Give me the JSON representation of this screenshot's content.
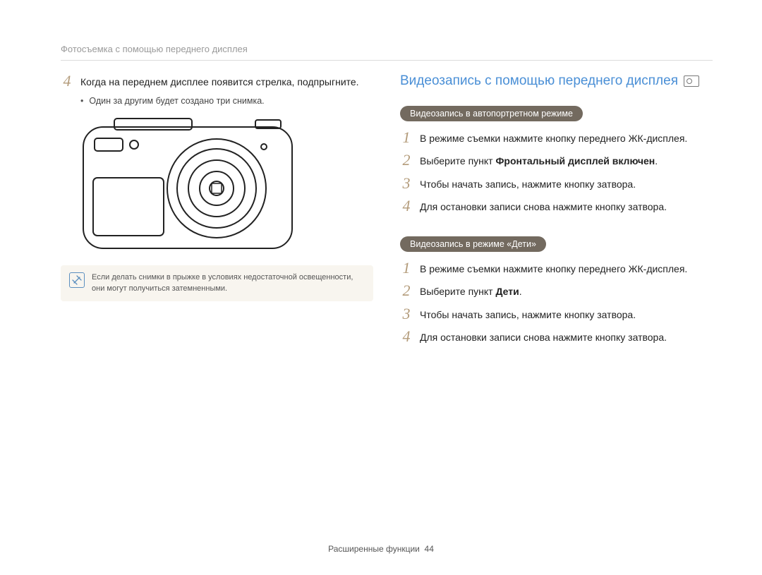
{
  "breadcrumb": "Фотосъемка с помощью переднего дисплея",
  "left": {
    "step4": "Когда на переднем дисплее появится стрелка, подпрыгните.",
    "bullet": "Один за другим будет создано три снимка.",
    "note": "Если делать снимки в прыжке в условиях недостаточной освещенности, они могут получиться затемненными."
  },
  "right": {
    "heading": "Видеозапись с помощью переднего дисплея",
    "section1": {
      "title": "Видеозапись в автопортретном режиме",
      "step1": "В режиме съемки нажмите кнопку переднего ЖК-дисплея.",
      "step2_pre": "Выберите пункт ",
      "step2_bold": "Фронтальный дисплей включен",
      "step2_post": ".",
      "step3": "Чтобы начать запись, нажмите кнопку затвора.",
      "step4": "Для остановки записи снова нажмите кнопку затвора."
    },
    "section2": {
      "title": "Видеозапись в режиме «Дети»",
      "step1": "В режиме съемки нажмите кнопку переднего ЖК-дисплея.",
      "step2_pre": "Выберите пункт ",
      "step2_bold": "Дети",
      "step2_post": ".",
      "step3": "Чтобы начать запись, нажмите кнопку затвора.",
      "step4": "Для остановки записи снова нажмите кнопку затвора."
    }
  },
  "nums": {
    "n1": "1",
    "n2": "2",
    "n3": "3",
    "n4": "4"
  },
  "footer": {
    "label": "Расширенные функции",
    "page": "44"
  }
}
